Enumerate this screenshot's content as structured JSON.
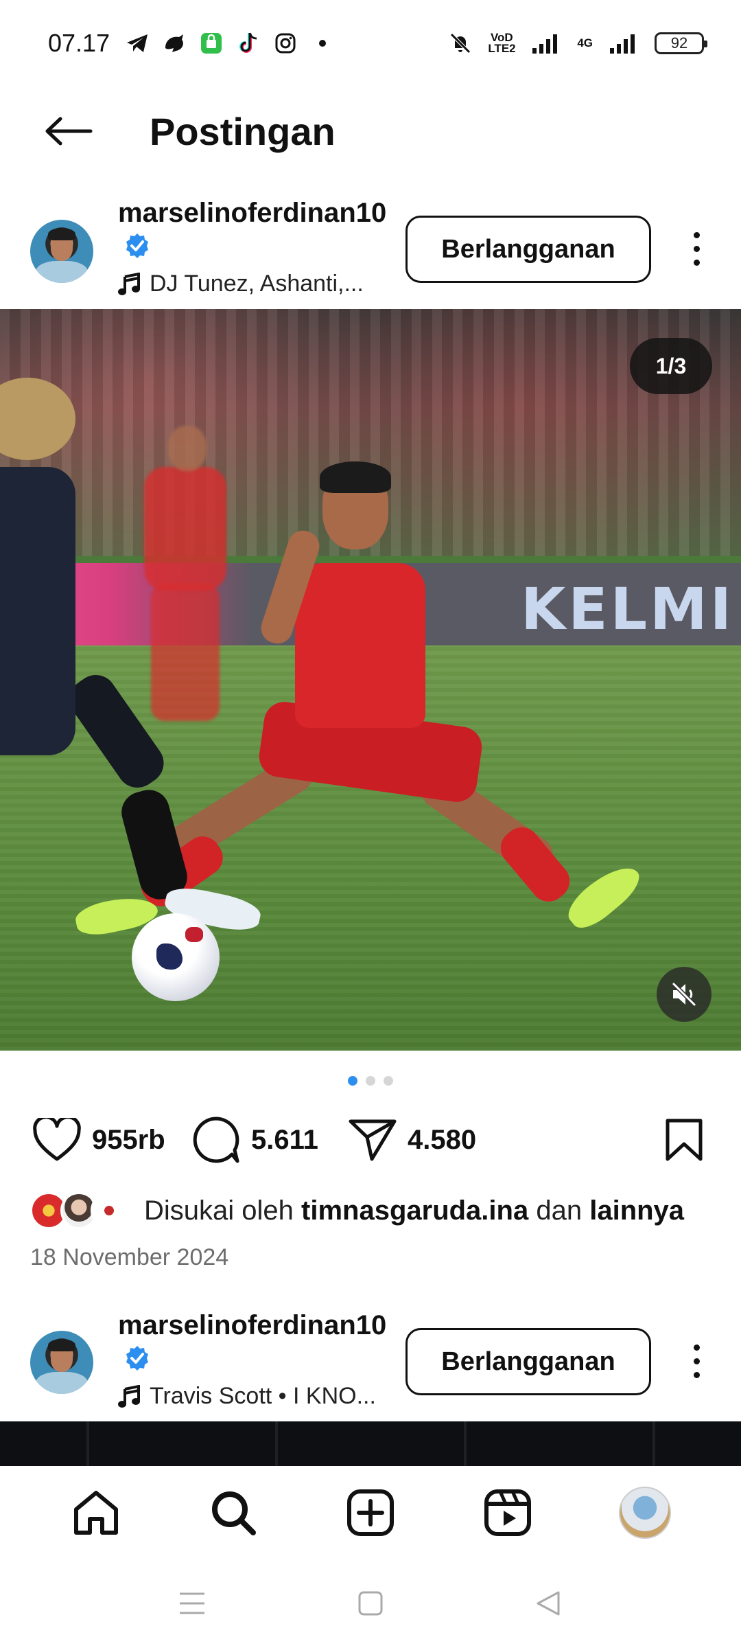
{
  "status_bar": {
    "time": "07.17",
    "battery": "92",
    "network_label_1": "VoD LTE2",
    "network_label_2": "4G"
  },
  "header": {
    "title": "Postingan"
  },
  "post": {
    "username": "marselinoferdinan10",
    "music": "DJ Tunez, Ashanti,...",
    "subscribe_label": "Berlangganan",
    "image_counter": "1/3",
    "image_text": "KELMI",
    "likes": "955rb",
    "comments": "5.611",
    "shares": "4.580",
    "liked_by_prefix": "Disukai oleh",
    "liked_by_user": "timnasgaruda.ina",
    "liked_by_joiner": "dan",
    "liked_by_others": "lainnya",
    "date": "18 November 2024",
    "carousel_total": 3,
    "carousel_active": 1
  },
  "next_post": {
    "username": "marselinoferdinan10",
    "music": "Travis Scott • I KNO...",
    "subscribe_label": "Berlangganan"
  },
  "nav": {
    "items": [
      "home-icon",
      "search-icon",
      "create-icon",
      "reels-icon",
      "profile-avatar"
    ]
  },
  "colors": {
    "accent": "#2c8ff0",
    "verified": "#2c8ff0"
  }
}
